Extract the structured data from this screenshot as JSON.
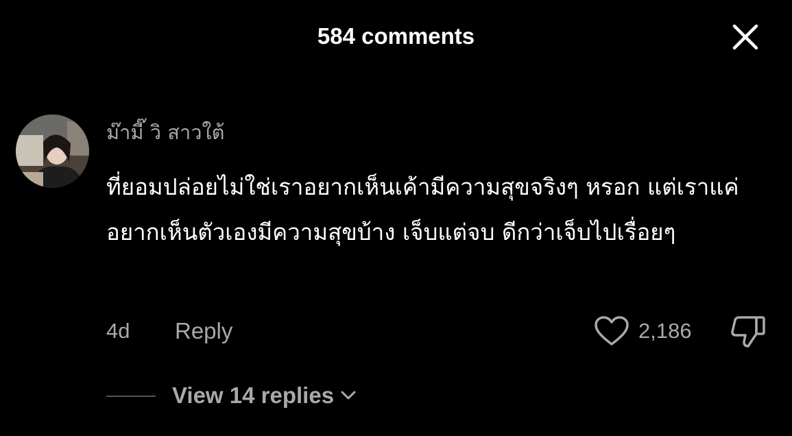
{
  "header": {
    "title": "584 comments",
    "close_icon": "close-icon"
  },
  "comment": {
    "username": "ม๊ามี๊ วิ สาวใต้",
    "text": "ที่ยอมปล่อยไม่ใช่เราอยากเห็นเค้ามีความสุขจริงๆ หรอก แต่เราแค่อยากเห็นตัวเองมีความสุขบ้าง เจ็บแต่จบ ดีกว่าเจ็บไปเรื่อยๆ",
    "time": "4d",
    "reply_label": "Reply",
    "like_count": "2,186",
    "like_icon": "heart-icon",
    "dislike_icon": "thumbs-down-icon"
  },
  "replies": {
    "label": "View 14 replies",
    "icon": "chevron-down-icon"
  },
  "colors": {
    "background": "#000000",
    "primary_text": "#ffffff",
    "secondary_text": "#a9a9a9"
  }
}
